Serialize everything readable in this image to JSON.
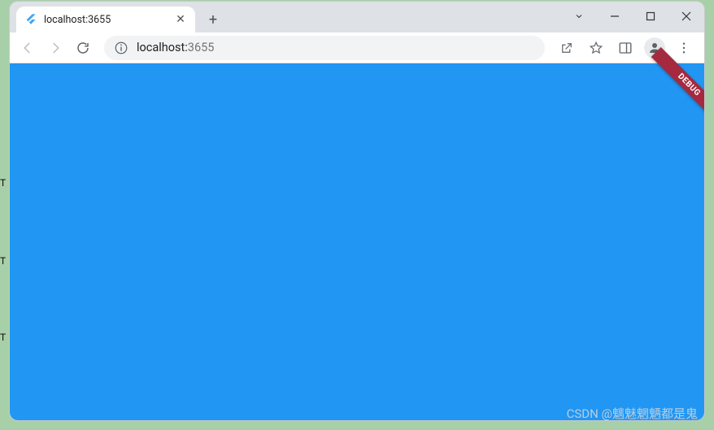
{
  "tab": {
    "title": "localhost:3655"
  },
  "url": {
    "host": "localhost:",
    "port": "3655"
  },
  "debug": {
    "label": "DEBUG"
  },
  "watermark": "CSDN @魑魅魍魉都是鬼",
  "edge_labels": [
    "T",
    "T",
    "T"
  ],
  "colors": {
    "content_bg": "#2196f3",
    "banner_bg": "#a52a3f"
  }
}
